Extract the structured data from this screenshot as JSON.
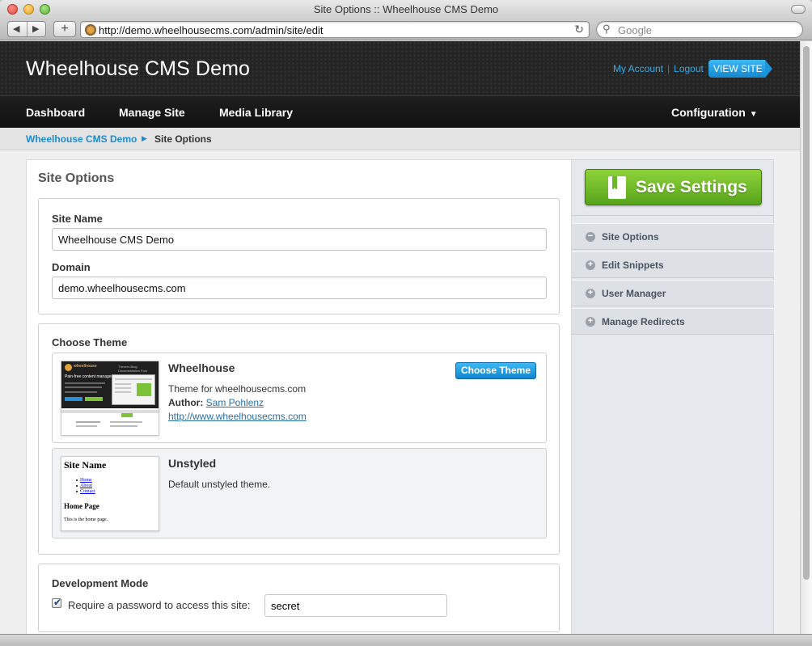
{
  "browser": {
    "window_title": "Site Options :: Wheelhouse CMS Demo",
    "url": "http://demo.wheelhousecms.com/admin/site/edit",
    "search_placeholder": "Google"
  },
  "header": {
    "site_title": "Wheelhouse CMS Demo",
    "my_account": "My Account",
    "separator": "|",
    "logout": "Logout",
    "view_site": "VIEW SITE"
  },
  "nav": {
    "dashboard": "Dashboard",
    "manage_site": "Manage Site",
    "media_library": "Media Library",
    "configuration": "Configuration"
  },
  "breadcrumb": {
    "root": "Wheelhouse CMS Demo",
    "current": "Site Options"
  },
  "page": {
    "title": "Site Options",
    "site_name_label": "Site Name",
    "site_name_value": "Wheelhouse CMS Demo",
    "domain_label": "Domain",
    "domain_value": "demo.wheelhousecms.com",
    "choose_theme_label": "Choose Theme",
    "themes": [
      {
        "name": "Wheelhouse",
        "description": "Theme for wheelhousecms.com",
        "author_label": "Author:",
        "author": "Sam Pohlenz",
        "url": "http://www.wheelhousecms.com",
        "button": "Choose Theme"
      },
      {
        "name": "Unstyled",
        "description": "Default unstyled theme."
      }
    ],
    "dev_mode_label": "Development Mode",
    "require_password_label": "Require a password to access this site:",
    "require_password_checked": true,
    "password_value": "secret"
  },
  "theme_previews": {
    "wheelhouse": {
      "logo_text": "wheelhouse",
      "nav_text": "Themes  Blog  Documentation  Fork",
      "headline": "Pain-free content management"
    },
    "unstyled": {
      "site_name": "Site Name",
      "links": [
        "Home",
        "About",
        "Contact"
      ],
      "heading": "Home Page",
      "body": "This is the home page."
    }
  },
  "sidebar": {
    "save_button": "Save Settings",
    "items": [
      {
        "label": "Site Options",
        "icon": "minus-circle-icon"
      },
      {
        "label": "Edit Snippets",
        "icon": "plus-circle-icon"
      },
      {
        "label": "User Manager",
        "icon": "plus-circle-icon"
      },
      {
        "label": "Manage Redirects",
        "icon": "plus-circle-icon"
      }
    ]
  },
  "colors": {
    "accent_blue": "#1b8bce",
    "save_green": "#6cb82b",
    "header_dark": "#242424"
  }
}
